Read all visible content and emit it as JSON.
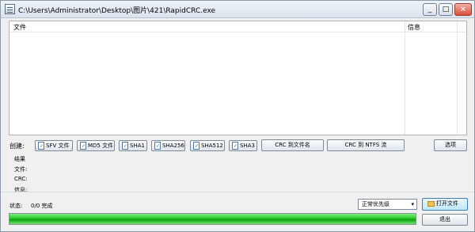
{
  "window": {
    "title": "C:\\Users\\Administrator\\Desktop\\图片\\421\\RapidCRC.exe",
    "controls": {
      "minimize": "_",
      "maximize": "□",
      "close": "×"
    }
  },
  "table": {
    "columns": [
      "文件",
      "信息"
    ],
    "rows": []
  },
  "toolbar": {
    "create_label": "创建:",
    "buttons": [
      "SFV 文件",
      "MD5 文件",
      "SHA1",
      "SHA256",
      "SHA512",
      "SHA3"
    ],
    "crc_to_filename": "CRC 到文件名",
    "crc_to_ntfs": "CRC 到 NTFS 流",
    "options": "选项"
  },
  "results": {
    "heading": "结果",
    "file": "文件:",
    "crc": "CRC:",
    "info": "信息:"
  },
  "status": {
    "label": "状态:",
    "value": "0/0 完成"
  },
  "priority": {
    "selected": "正常优先级"
  },
  "actions": {
    "open_file": "打开文件",
    "exit": "退出"
  },
  "progress": {
    "percent": 100
  },
  "colors": {
    "progress_fill": "#25c925",
    "window_background": "#f0f0f0"
  }
}
